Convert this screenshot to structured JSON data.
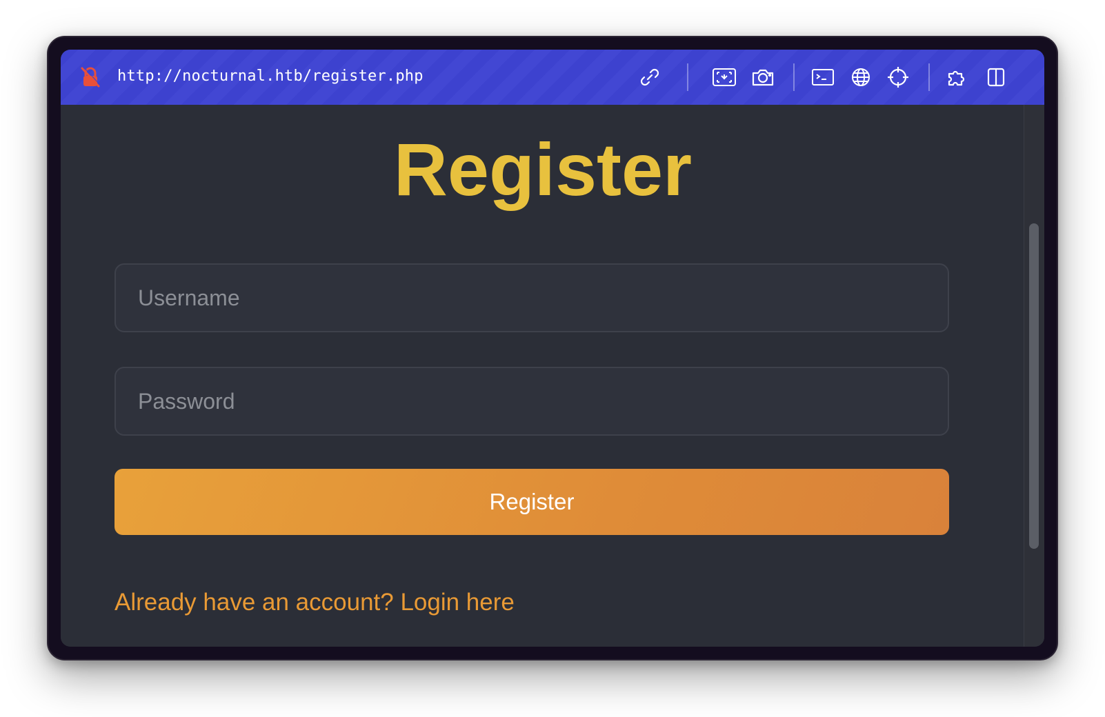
{
  "toolbar": {
    "url": "http://nocturnal.htb/register.php",
    "accent_color": "#3d42cf",
    "icons": [
      "lock-off-icon",
      "link-icon",
      "image-capture-icon",
      "camera-icon",
      "terminal-icon",
      "globe-icon",
      "crosshair-icon",
      "extension-icon",
      "split-view-icon"
    ]
  },
  "page": {
    "title": "Register",
    "title_color": "#e8c13e",
    "username_placeholder": "Username",
    "password_placeholder": "Password",
    "submit_label": "Register",
    "login_link": "Already have an account? Login here",
    "link_color": "#e99a35"
  }
}
